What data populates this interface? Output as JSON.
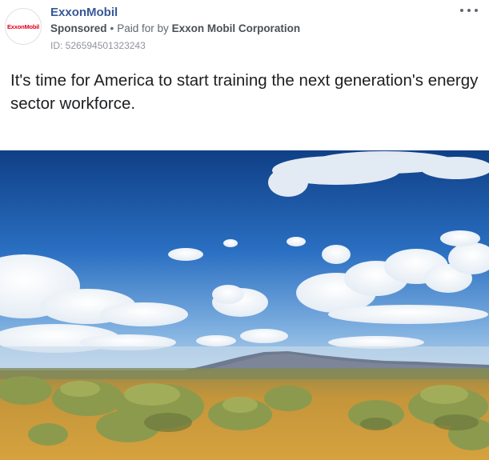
{
  "advertiser": {
    "name": "ExxonMobil",
    "logo_text": "ExxonMobil",
    "logo_color": "#e0001b",
    "name_color": "#385898"
  },
  "sponsorship": {
    "sponsored_label": "Sponsored",
    "separator": "•",
    "paid_for_prefix": "Paid for by",
    "payer": "Exxon Mobil Corporation"
  },
  "ad_id": "ID: 526594501323243",
  "menu": {
    "icon": "more-horizontal-icon"
  },
  "post": {
    "text": "It's time for America to start training the next generation's energy sector workforce."
  },
  "image": {
    "subject": "desert-landscape-photo",
    "sky_color": "#1f5aa8",
    "ground_color": "#c89a3a"
  }
}
